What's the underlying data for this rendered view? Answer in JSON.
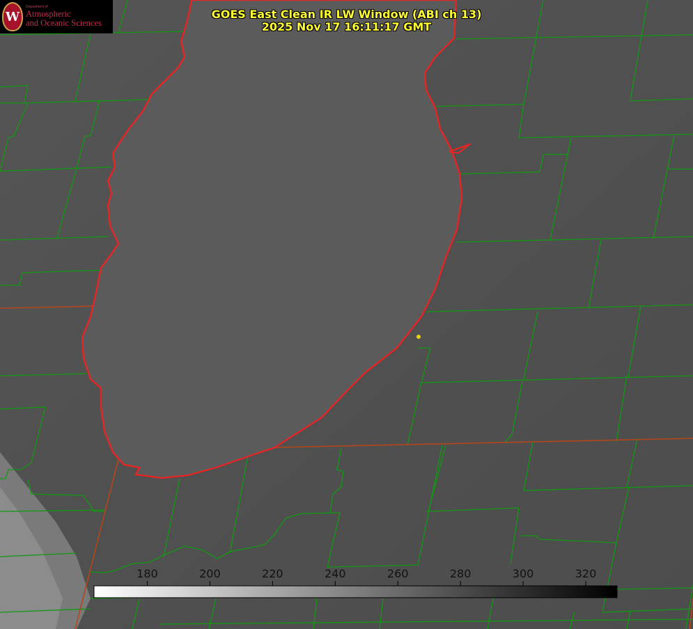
{
  "header": {
    "logo": {
      "seal_letter": "W",
      "department": "Department of",
      "line1": "Atmospheric",
      "line2": "and Oceanic Sciences"
    },
    "title_line1": "GOES East Clean IR LW Window (ABI ch 13)",
    "title_line2": "2025 Nov 17 16:11:17 GMT"
  },
  "colorbar": {
    "ticks": [
      "180",
      "200",
      "220",
      "240",
      "260",
      "280",
      "300",
      "320"
    ],
    "tick_values": [
      180,
      200,
      220,
      240,
      260,
      280,
      300,
      320
    ],
    "range": [
      163,
      330
    ],
    "gradient": [
      "#ffffff",
      "#000000"
    ]
  },
  "map": {
    "lake_fill": "#5a5a5a",
    "land_fill": "#525252",
    "county_line_color": "#119911",
    "state_line_color": "#c0392b",
    "lakeshore_color": "#ee2222",
    "marker_color": "#e6d21a"
  }
}
